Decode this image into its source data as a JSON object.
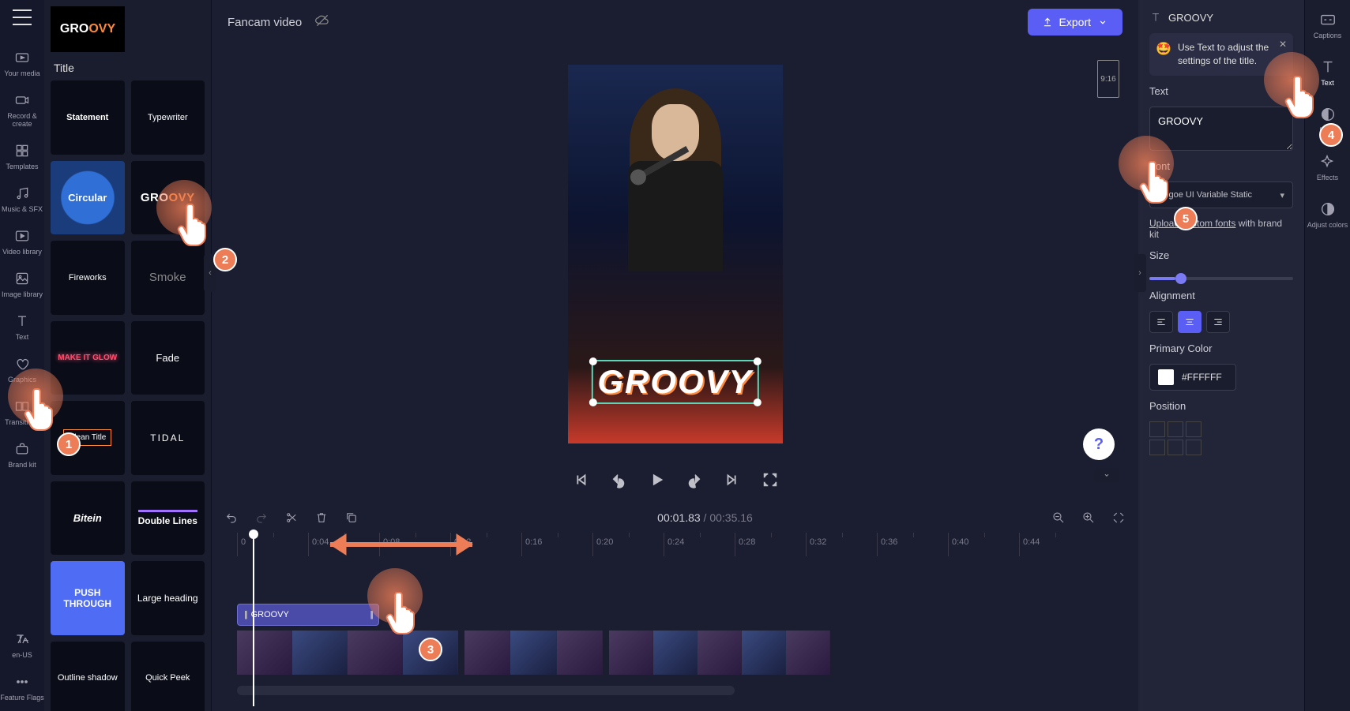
{
  "left_toolbar": {
    "items": [
      {
        "label": "Your media"
      },
      {
        "label": "Record & create"
      },
      {
        "label": "Templates"
      },
      {
        "label": "Music & SFX"
      },
      {
        "label": "Video library"
      },
      {
        "label": "Image library"
      },
      {
        "label": "Text"
      },
      {
        "label": "Graphics"
      },
      {
        "label": "Transitions"
      },
      {
        "label": "Brand kit"
      },
      {
        "label": "en-US"
      },
      {
        "label": "Feature Flags"
      }
    ]
  },
  "presets": {
    "featured": "GROOVY",
    "section_label": "Title",
    "items": [
      "Statement",
      "Typewriter",
      "Circular",
      "GROOVY",
      "Fireworks",
      "Smoke",
      "MAKE IT GLOW",
      "Fade",
      "Clean Title",
      "TIDAL",
      "Bitein",
      "Double Lines",
      "PUSH THROUGH",
      "Large heading",
      "Outline shadow",
      "Quick Peek"
    ]
  },
  "top_bar": {
    "project_name": "Fancam video",
    "export_label": "Export"
  },
  "preview": {
    "aspect_label": "9:16",
    "overlay_text": "GROOVY"
  },
  "help_label": "?",
  "playback": {
    "current_time": "00:01.83",
    "total_time": "00:35.16"
  },
  "ruler_ticks": [
    "0",
    "0:04",
    "0:08",
    "0:12",
    "0:16",
    "0:20",
    "0:24",
    "0:28",
    "0:32",
    "0:36",
    "0:40",
    "0:44"
  ],
  "timeline": {
    "text_clip_label": "GROOVY"
  },
  "right_panel": {
    "header": "GROOVY",
    "tip_text": "Use Text to adjust the settings of the title.",
    "text_label": "Text",
    "text_value": "GROOVY",
    "font_label": "Font",
    "font_value": "Segoe UI Variable Static",
    "upload_link": "Upload custom fonts",
    "upload_suffix": " with brand kit",
    "size_label": "Size",
    "alignment_label": "Alignment",
    "color_label": "Primary Color",
    "color_value": "#FFFFFF",
    "position_label": "Position"
  },
  "far_right": {
    "items": [
      "Captions",
      "Text",
      "Fade",
      "Effects",
      "Adjust colors"
    ]
  },
  "annotations": {
    "p1": "1",
    "p2": "2",
    "p3": "3",
    "p4": "4",
    "p5": "5"
  }
}
